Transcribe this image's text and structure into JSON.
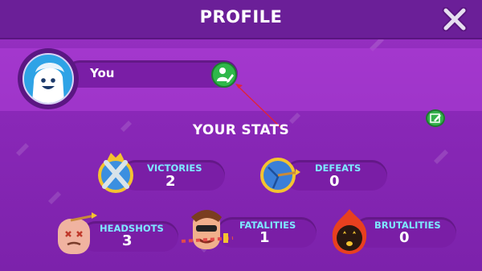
{
  "header": {
    "title": "PROFILE",
    "close_icon": "close-x-icon"
  },
  "profile": {
    "name": "You",
    "avatar_icon": "smiling-character-avatar",
    "edit_icon": "edit-profile-icon"
  },
  "stats_title": "YOUR STATS",
  "stats": [
    {
      "label": "VICTORIES",
      "value": "2",
      "icon": "crowned-crossed-swords-icon"
    },
    {
      "label": "DEFEATS",
      "value": "0",
      "icon": "arrow-target-icon"
    },
    {
      "label": "HEADSHOTS",
      "value": "3",
      "icon": "arrow-through-head-icon"
    },
    {
      "label": "FATALITIES",
      "value": "1",
      "icon": "sword-through-head-icon"
    },
    {
      "label": "BRUTALITIES",
      "value": "0",
      "icon": "flaming-head-icon"
    }
  ],
  "colors": {
    "background": "#8a28b8",
    "header": "#6b1f98",
    "stat_label": "#7ee9ff",
    "bar": "#7a1ea6",
    "button_green": "#2fb84a",
    "annotation_arrow": "#e0233a"
  }
}
